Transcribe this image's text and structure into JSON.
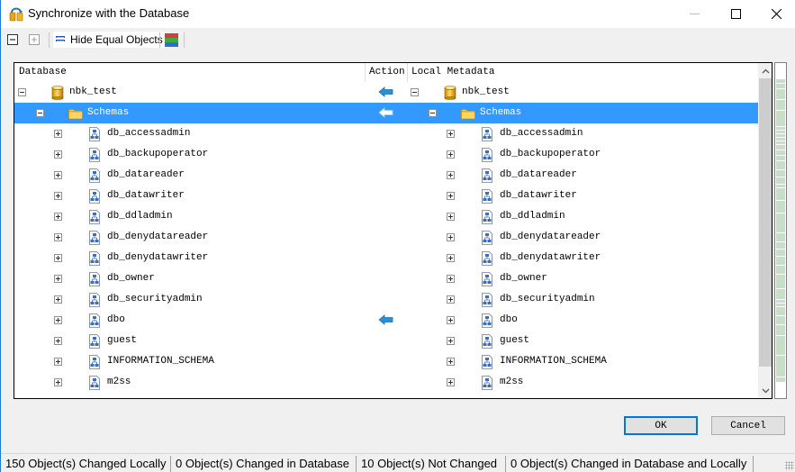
{
  "window": {
    "title": "Synchronize with the Database",
    "minimize_label": "—",
    "maximize_label": "☐",
    "close_label": "✕"
  },
  "toolbar": {
    "collapse_all_icon": "collapse-icon",
    "expand_all_icon": "expand-icon",
    "hide_equal_label": "Hide Equal Objects",
    "color_legend_icon": "color-legend-icon"
  },
  "grid": {
    "columns": {
      "database": "Database",
      "action": "Action",
      "local": "Local Metadata"
    },
    "rows": [
      {
        "level": 0,
        "name": "nbk_test",
        "type": "database",
        "expanded": true,
        "action": "arrow-left",
        "selected": false
      },
      {
        "level": 1,
        "name": "Schemas",
        "type": "folder",
        "expanded": true,
        "action": "arrow-left-light",
        "selected": true
      },
      {
        "level": 2,
        "name": "db_accessadmin",
        "type": "schema",
        "expanded": false,
        "action": "",
        "selected": false
      },
      {
        "level": 2,
        "name": "db_backupoperator",
        "type": "schema",
        "expanded": false,
        "action": "",
        "selected": false
      },
      {
        "level": 2,
        "name": "db_datareader",
        "type": "schema",
        "expanded": false,
        "action": "",
        "selected": false
      },
      {
        "level": 2,
        "name": "db_datawriter",
        "type": "schema",
        "expanded": false,
        "action": "",
        "selected": false
      },
      {
        "level": 2,
        "name": "db_ddladmin",
        "type": "schema",
        "expanded": false,
        "action": "",
        "selected": false
      },
      {
        "level": 2,
        "name": "db_denydatareader",
        "type": "schema",
        "expanded": false,
        "action": "",
        "selected": false
      },
      {
        "level": 2,
        "name": "db_denydatawriter",
        "type": "schema",
        "expanded": false,
        "action": "",
        "selected": false
      },
      {
        "level": 2,
        "name": "db_owner",
        "type": "schema",
        "expanded": false,
        "action": "",
        "selected": false
      },
      {
        "level": 2,
        "name": "db_securityadmin",
        "type": "schema",
        "expanded": false,
        "action": "",
        "selected": false
      },
      {
        "level": 2,
        "name": "dbo",
        "type": "schema",
        "expanded": false,
        "action": "arrow-left",
        "selected": false
      },
      {
        "level": 2,
        "name": "guest",
        "type": "schema",
        "expanded": false,
        "action": "",
        "selected": false
      },
      {
        "level": 2,
        "name": "INFORMATION_SCHEMA",
        "type": "schema",
        "expanded": false,
        "action": "",
        "selected": false
      },
      {
        "level": 2,
        "name": "m2ss",
        "type": "schema",
        "expanded": false,
        "action": "",
        "selected": false
      }
    ]
  },
  "buttons": {
    "ok": "OK",
    "cancel": "Cancel"
  },
  "status": {
    "changed_locally": "150 Object(s) Changed Locally",
    "changed_in_database": "0 Object(s) Changed in Database",
    "not_changed": "10 Object(s) Not Changed",
    "changed_both": "0 Object(s) Changed in Database and Locally"
  },
  "colors": {
    "selection": "#3399ff",
    "accent": "#0078d7",
    "overview_fill": "#c7dec7",
    "arrow": "#2a8fd6"
  }
}
